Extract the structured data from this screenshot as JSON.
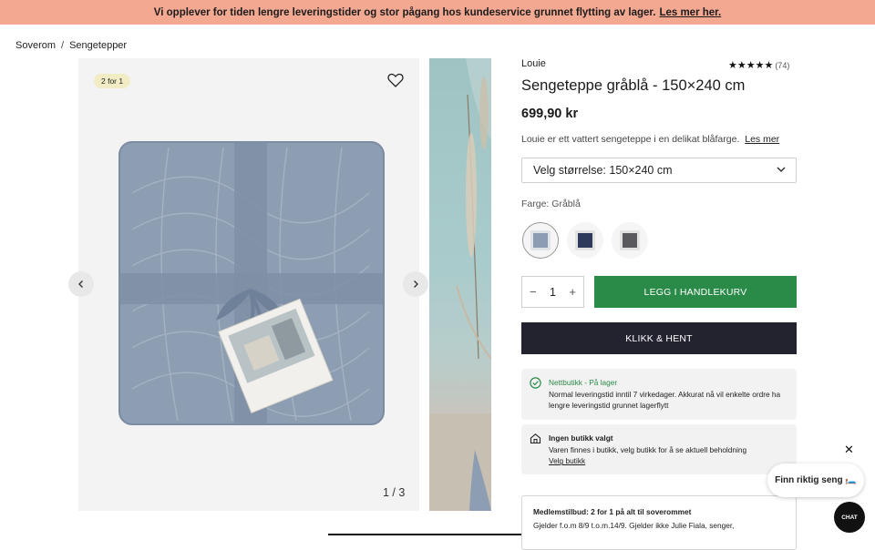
{
  "banner": {
    "text": "Vi opplever for tiden lengre leveringstider og stor pågang hos kundeservice grunnet flytting av lager.",
    "link": "Les mer her."
  },
  "breadcrumb": {
    "items": [
      "Soverom",
      "Sengetepper"
    ],
    "separator": "/"
  },
  "gallery": {
    "badge": "2 for 1",
    "counter": "1 / 3",
    "favorite_icon": "heart-icon",
    "prev_icon": "chevron-left-icon",
    "next_icon": "chevron-right-icon"
  },
  "product": {
    "brand": "Louie",
    "rating_count": "(74)",
    "rating_stars": 5,
    "title": "Sengeteppe gråblå - 150×240 cm",
    "price": "699,90 kr",
    "description": "Louie er ett vattert sengeteppe i en delikat blåfarge.",
    "description_link": "Les mer",
    "size_select": "Velg størrelse: 150×240 cm",
    "color_label_prefix": "Farge:",
    "color_value": "Gråblå",
    "swatches": [
      {
        "name": "Gråblå",
        "color": "#8c9cb2",
        "active": true
      },
      {
        "name": "Mørkeblå",
        "color": "#2e3a5c",
        "active": false
      },
      {
        "name": "Grå",
        "color": "#5a5a5e",
        "active": false
      }
    ],
    "quantity": "1",
    "qty_minus": "−",
    "qty_plus": "+",
    "add_to_cart": "LEGG I HANDLEKURV",
    "click_collect": "KLIKK & HENT"
  },
  "stock": {
    "online_status": "Nettbutikk - På lager",
    "online_text": "Normal leveringstid inntil 7 virkedager. Akkurat nå vil enkelte ordre ha lengre leveringstid grunnet lagerflytt",
    "store_title": "Ingen butikk valgt",
    "store_text": "Varen finnes i butikk, velg butikk for å se aktuell beholdning",
    "store_link": "Velg butikk"
  },
  "member": {
    "title": "Medlemstilbud: 2 for 1 på alt til soverommet",
    "text": "Gjelder f.o.m 8/9 t.o.m.14/9. Gjelder ikke Julie Fiala, senger,"
  },
  "widgets": {
    "close": "✕",
    "finn_seng": "Finn riktig seng 🛏️",
    "chat": "CHAT"
  },
  "colors": {
    "banner": "#f3a891",
    "add_button": "#2a8a48",
    "click_button": "#23222f"
  }
}
